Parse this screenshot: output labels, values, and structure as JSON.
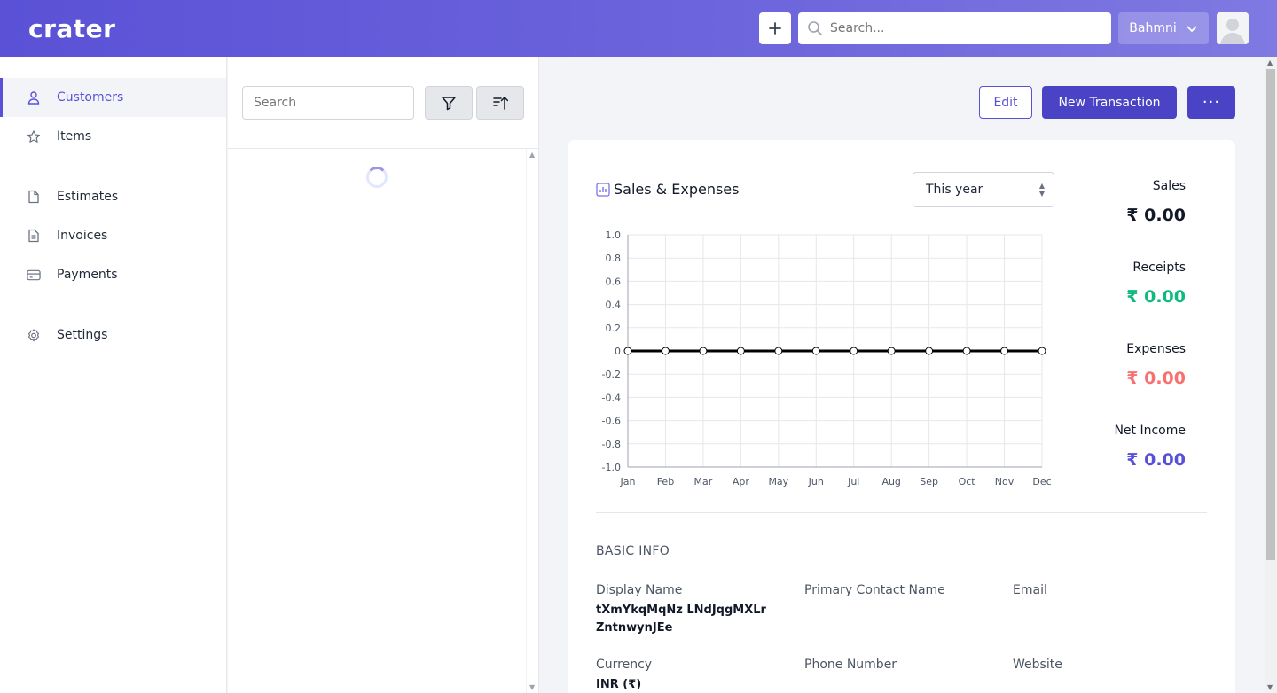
{
  "header": {
    "logo": "crater",
    "search_placeholder": "Search...",
    "company": "Bahmni"
  },
  "sidebar": {
    "items": [
      {
        "label": "Customers",
        "icon": "user-icon"
      },
      {
        "label": "Items",
        "icon": "star-icon"
      },
      {
        "label": "Estimates",
        "icon": "document-icon"
      },
      {
        "label": "Invoices",
        "icon": "invoice-icon"
      },
      {
        "label": "Payments",
        "icon": "card-icon"
      },
      {
        "label": "Settings",
        "icon": "gear-icon"
      }
    ]
  },
  "list": {
    "search_placeholder": "Search"
  },
  "actions": {
    "edit": "Edit",
    "new_transaction": "New Transaction",
    "more": "···"
  },
  "chart_section": {
    "title": "Sales & Expenses",
    "period": "This year"
  },
  "stats": {
    "sales_label": "Sales",
    "sales_value": "₹ 0.00",
    "receipts_label": "Receipts",
    "receipts_value": "₹ 0.00",
    "expenses_label": "Expenses",
    "expenses_value": "₹ 0.00",
    "net_label": "Net Income",
    "net_value": "₹ 0.00"
  },
  "colors": {
    "brand": "#5851d8",
    "sales": "#111827",
    "receipts": "#10b981",
    "expenses": "#f87171",
    "net": "#5851d8"
  },
  "basic_info": {
    "title": "BASIC INFO",
    "display_name_label": "Display Name",
    "display_name": "tXmYkqMqNz LNdJqgMXLr ZntnwynJEe",
    "primary_contact_label": "Primary Contact Name",
    "email_label": "Email",
    "currency_label": "Currency",
    "currency": "INR (₹)",
    "phone_label": "Phone Number",
    "website_label": "Website"
  },
  "chart_data": {
    "type": "line",
    "categories": [
      "Jan",
      "Feb",
      "Mar",
      "Apr",
      "May",
      "Jun",
      "Jul",
      "Aug",
      "Sep",
      "Oct",
      "Nov",
      "Dec"
    ],
    "values": [
      0,
      0,
      0,
      0,
      0,
      0,
      0,
      0,
      0,
      0,
      0,
      0
    ],
    "yticks": [
      "1.0",
      "0.8",
      "0.6",
      "0.4",
      "0.2",
      "0",
      "-0.2",
      "-0.4",
      "-0.6",
      "-0.8",
      "-1.0"
    ],
    "ylim": [
      -1.0,
      1.0
    ],
    "grid": true
  }
}
